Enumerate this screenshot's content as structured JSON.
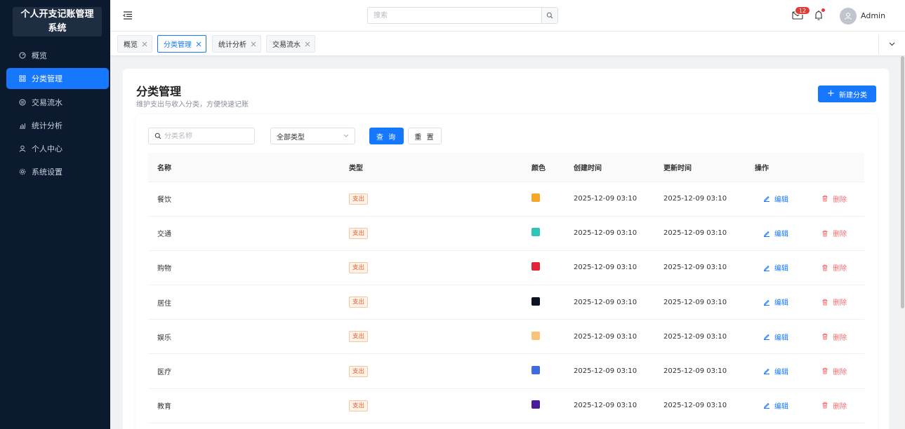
{
  "app": {
    "title": "个人开支记账管理系统",
    "title_line1": "个人开支记账管理",
    "title_line2": "系统"
  },
  "sidebar": {
    "items": [
      {
        "label": "概览",
        "icon": "dashboard-icon",
        "active": false
      },
      {
        "label": "分类管理",
        "icon": "grid-icon",
        "active": true
      },
      {
        "label": "交易流水",
        "icon": "transaction-icon",
        "active": false
      },
      {
        "label": "统计分析",
        "icon": "chart-icon",
        "active": false
      },
      {
        "label": "个人中心",
        "icon": "user-icon",
        "active": false
      },
      {
        "label": "系统设置",
        "icon": "settings-icon",
        "active": false
      }
    ]
  },
  "header": {
    "search_placeholder": "搜索",
    "mail_badge": "12",
    "username": "Admin"
  },
  "tabs": [
    {
      "label": "概览",
      "active": false
    },
    {
      "label": "分类管理",
      "active": true
    },
    {
      "label": "统计分析",
      "active": false
    },
    {
      "label": "交易流水",
      "active": false
    }
  ],
  "page": {
    "title": "分类管理",
    "subtitle": "维护支出与收入分类，方便快速记账",
    "new_button": "新建分类"
  },
  "filters": {
    "name_placeholder": "分类名称",
    "type_value": "全部类型",
    "query_button": "查 询",
    "reset_button": "重 置"
  },
  "table": {
    "columns": [
      "名称",
      "类型",
      "颜色",
      "创建时间",
      "更新时间",
      "操作"
    ],
    "edit_label": "编辑",
    "delete_label": "删除",
    "rows": [
      {
        "name": "餐饮",
        "type": "支出",
        "color": "#f5a623",
        "created": "2025-12-09 03:10",
        "updated": "2025-12-09 03:10"
      },
      {
        "name": "交通",
        "type": "支出",
        "color": "#2ec4b6",
        "created": "2025-12-09 03:10",
        "updated": "2025-12-09 03:10"
      },
      {
        "name": "购物",
        "type": "支出",
        "color": "#e3243b",
        "created": "2025-12-09 03:10",
        "updated": "2025-12-09 03:10"
      },
      {
        "name": "居住",
        "type": "支出",
        "color": "#0b1220",
        "created": "2025-12-09 03:10",
        "updated": "2025-12-09 03:10"
      },
      {
        "name": "娱乐",
        "type": "支出",
        "color": "#f9c27a",
        "created": "2025-12-09 03:10",
        "updated": "2025-12-09 03:10"
      },
      {
        "name": "医疗",
        "type": "支出",
        "color": "#4169e1",
        "created": "2025-12-09 03:10",
        "updated": "2025-12-09 03:10"
      },
      {
        "name": "教育",
        "type": "支出",
        "color": "#4b1b9e",
        "created": "2025-12-09 03:10",
        "updated": "2025-12-09 03:10"
      }
    ]
  },
  "colors": {
    "primary": "#1677ff",
    "sidebar_bg": "#0c1a30",
    "danger": "#f56c6c",
    "expense_tag": "#e6612a"
  }
}
